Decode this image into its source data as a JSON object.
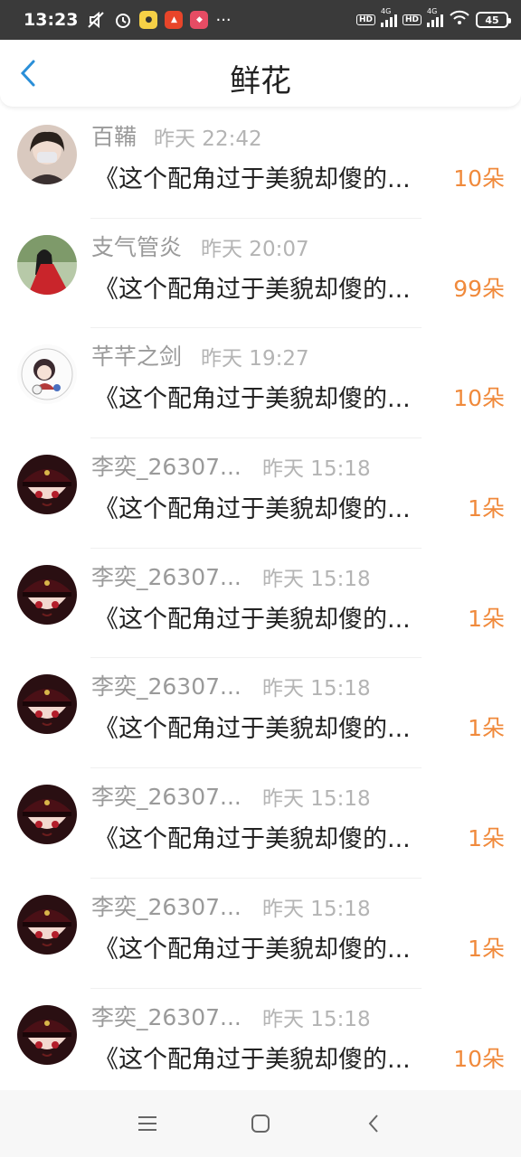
{
  "status": {
    "time": "13:23",
    "network1": "4G",
    "network2": "4G",
    "battery": "45",
    "more": "···"
  },
  "header": {
    "title": "鲜花"
  },
  "items": [
    {
      "name": "百鞴",
      "time": "昨天 22:42",
      "work": "《这个配角过于美貌却傻的...",
      "count": "10朵",
      "avatar": "woman-selfie"
    },
    {
      "name": "支气管炎",
      "time": "昨天 20:07",
      "work": "《这个配角过于美貌却傻的...",
      "count": "99朵",
      "avatar": "red-robe"
    },
    {
      "name": "芊芊之剑",
      "time": "昨天 19:27",
      "work": "《这个配角过于美貌却傻的...",
      "count": "10朵",
      "avatar": "chibi"
    },
    {
      "name": "李奕_26307...",
      "time": "昨天 15:18",
      "work": "《这个配角过于美貌却傻的...",
      "count": "1朵",
      "avatar": "anime-cap"
    },
    {
      "name": "李奕_26307...",
      "time": "昨天 15:18",
      "work": "《这个配角过于美貌却傻的...",
      "count": "1朵",
      "avatar": "anime-cap"
    },
    {
      "name": "李奕_26307...",
      "time": "昨天 15:18",
      "work": "《这个配角过于美貌却傻的...",
      "count": "1朵",
      "avatar": "anime-cap"
    },
    {
      "name": "李奕_26307...",
      "time": "昨天 15:18",
      "work": "《这个配角过于美貌却傻的...",
      "count": "1朵",
      "avatar": "anime-cap"
    },
    {
      "name": "李奕_26307...",
      "time": "昨天 15:18",
      "work": "《这个配角过于美貌却傻的...",
      "count": "1朵",
      "avatar": "anime-cap"
    },
    {
      "name": "李奕_26307...",
      "time": "昨天 15:18",
      "work": "《这个配角过于美貌却傻的...",
      "count": "10朵",
      "avatar": "anime-cap"
    }
  ],
  "colors": {
    "accent": "#f08a3c",
    "back": "#2a8fd8",
    "status_bg": "#3a3a3a"
  },
  "nav": {
    "menu_icon": "menu-icon",
    "home_icon": "home-icon",
    "back_icon": "back-icon"
  }
}
